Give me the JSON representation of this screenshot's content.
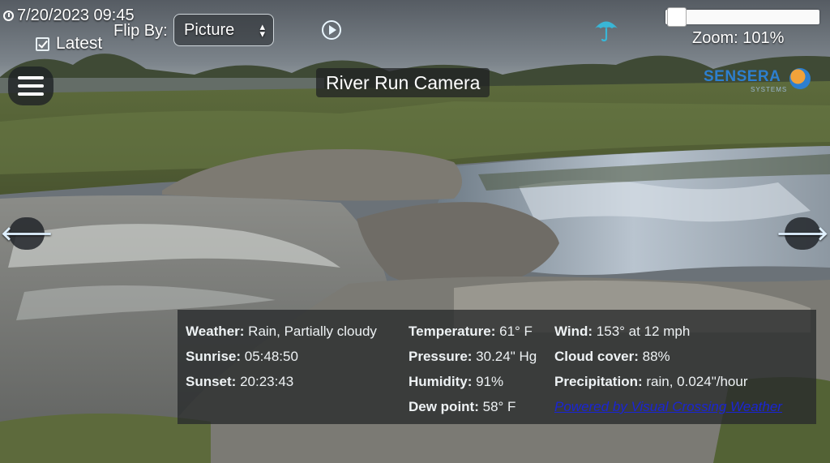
{
  "header": {
    "timestamp": "7/20/2023 09:45",
    "latest_label": "Latest",
    "flip_by_label": "Flip By:",
    "flip_by_value": "Picture",
    "zoom_text": "Zoom: 101%",
    "zoom_level": 0.01
  },
  "camera": {
    "title": "River Run Camera",
    "logo_text": "SENSERA",
    "logo_sub": "SYSTEMS"
  },
  "nav": {
    "prev": "🡐",
    "next": "🡒"
  },
  "weather": {
    "weather_label": "Weather:",
    "weather_value": "Rain, Partially cloudy",
    "temperature_label": "Temperature:",
    "temperature_value": "61° F",
    "wind_label": "Wind:",
    "wind_value": "153° at 12 mph",
    "sunrise_label": "Sunrise:",
    "sunrise_value": "05:48:50",
    "pressure_label": "Pressure:",
    "pressure_value": "30.24\" Hg",
    "cloud_label": "Cloud cover:",
    "cloud_value": "88%",
    "sunset_label": "Sunset:",
    "sunset_value": "20:23:43",
    "humidity_label": "Humidity:",
    "humidity_value": "91%",
    "precip_label": "Precipitation:",
    "precip_value": "rain, 0.024\"/hour",
    "dew_label": "Dew point:",
    "dew_value": "58° F",
    "powered_by": "Powered by Visual Crossing Weather"
  },
  "icons": {
    "clock": "clock-icon",
    "checkbox": "checkbox-icon",
    "play": "play-icon",
    "umbrella": "umbrella-icon",
    "menu": "hamburger-menu-icon",
    "arrow_left": "arrow-left-icon",
    "arrow_right": "arrow-right-icon"
  },
  "colors": {
    "accent": "#2d7fcf",
    "link": "#1a25d4",
    "panel": "#2a2c2e",
    "umbrella": "#39b6d6"
  }
}
